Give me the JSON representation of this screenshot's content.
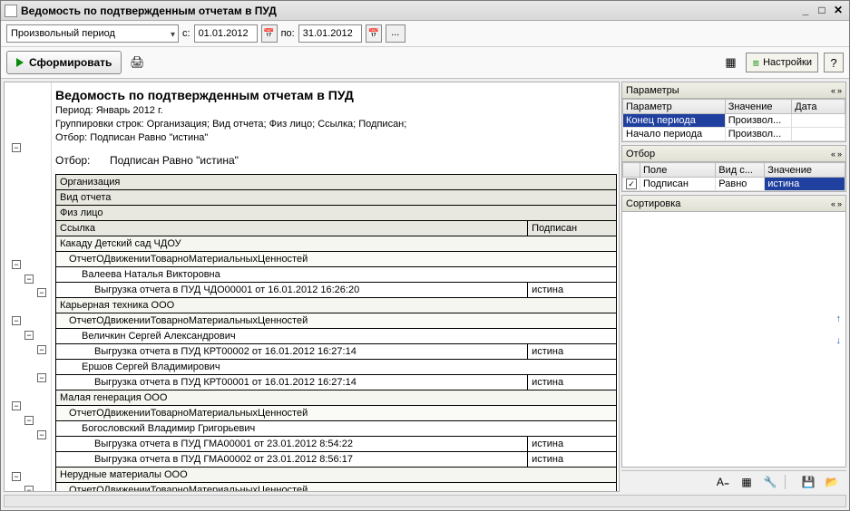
{
  "window": {
    "title": "Ведомость по подтвержденным отчетам в ПУД"
  },
  "toolbar1": {
    "period_type": "Произвольный период",
    "from_lbl": "с:",
    "date_from": "01.01.2012",
    "to_lbl": "по:",
    "date_to": "31.01.2012"
  },
  "toolbar2": {
    "run": "Сформировать",
    "settings": "Настройки"
  },
  "report": {
    "title": "Ведомость по подтвержденным отчетам в ПУД",
    "period": "Период: Январь 2012 г.",
    "groupings": "Группировки строк: Организация; Вид отчета; Физ лицо; Ссылка; Подписан;",
    "filter": "Отбор: Подписан Равно \"истина\"",
    "filter_lbl": "Отбор:",
    "filter_val": "Подписан Равно \"истина\"",
    "hdr_org": "Организация",
    "hdr_type": "Вид отчета",
    "hdr_person": "Физ лицо",
    "hdr_link": "Ссылка",
    "hdr_signed": "Подписан",
    "rows": {
      "o1": "Какаду Детский сад ЧДОУ",
      "t1": "ОтчетОДвиженииТоварноМатериальныхЦенностей",
      "p1": "Валеева Наталья Викторовна",
      "l1": "Выгрузка отчета в ПУД ЧДО00001 от 16.01.2012 16:26:20",
      "s1": "истина",
      "o2": "Карьерная техника ООО",
      "t2": "ОтчетОДвиженииТоварноМатериальныхЦенностей",
      "p2": "Величкин Сергей Александрович",
      "l2": "Выгрузка отчета в ПУД КРТ00002 от 16.01.2012 16:27:14",
      "s2": "истина",
      "p3": "Ершов Сергей Владимирович",
      "l3": "Выгрузка отчета в ПУД КРТ00001 от 16.01.2012 16:27:14",
      "s3": "истина",
      "o3": "Малая генерация ООО",
      "t3": "ОтчетОДвиженииТоварноМатериальныхЦенностей",
      "p4": "Богословский Владимир Григорьевич",
      "l4": "Выгрузка отчета в ПУД ГМА00001 от 23.01.2012 8:54:22",
      "s4": "истина",
      "l5": "Выгрузка отчета в ПУД ГМА00002 от 23.01.2012 8:56:17",
      "s5": "истина",
      "o4": "Нерудные материалы ООО",
      "t4": "ОтчетОДвиженииТоварноМатериальныхЦенностей"
    }
  },
  "params": {
    "title": "Параметры",
    "h1": "Параметр",
    "h2": "Значение",
    "h3": "Дата",
    "r1p": "Конец периода",
    "r1v": "Произвол...",
    "r2p": "Начало периода",
    "r2v": "Произвол..."
  },
  "otbor": {
    "title": "Отбор",
    "h1": "Поле",
    "h2": "Вид с...",
    "h3": "Значение",
    "field": "Подписан",
    "comp": "Равно",
    "val": "истина"
  },
  "sort": {
    "title": "Сортировка"
  }
}
